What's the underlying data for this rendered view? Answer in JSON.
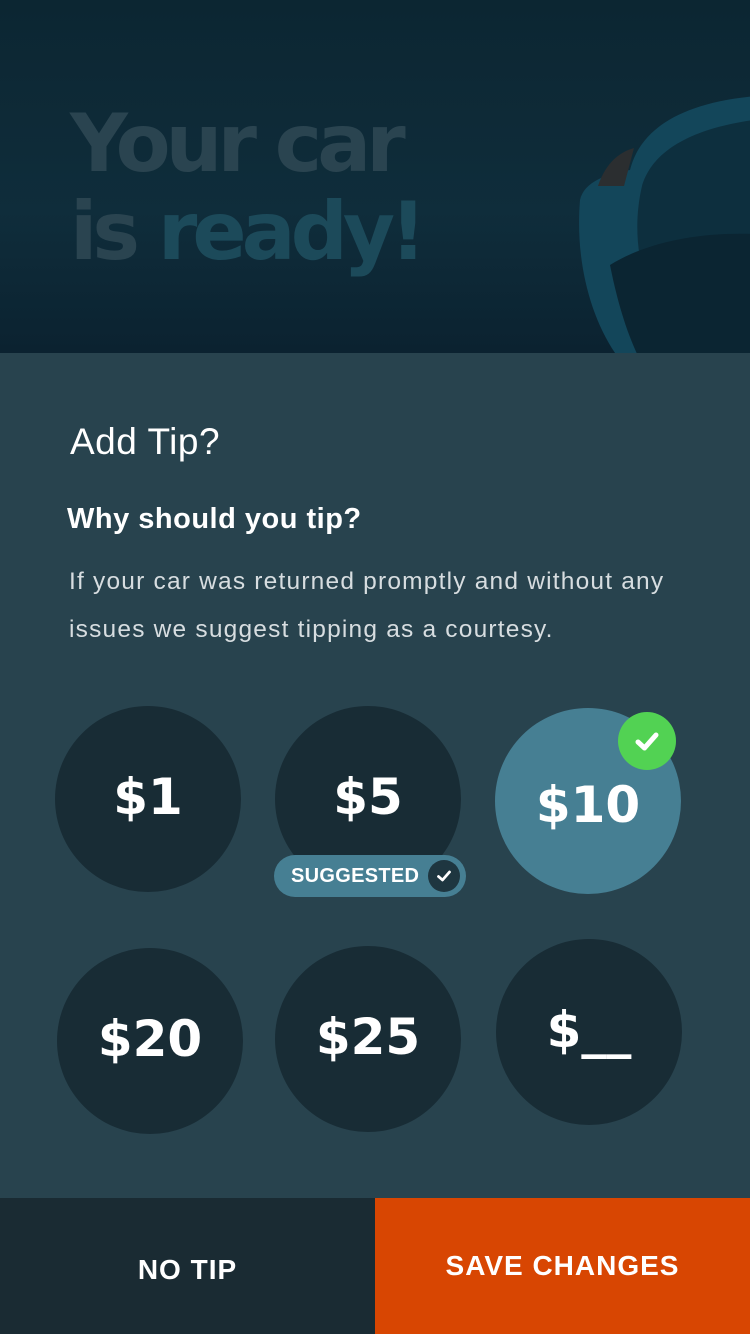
{
  "hero": {
    "title_line1": "Your car",
    "title_line2_a": "is",
    "title_line2_b": "ready!"
  },
  "sheet": {
    "title": "Add Tip?",
    "why_heading": "Why should you tip?",
    "why_body": "If your car was returned promptly and without any issues we suggest tipping as a courtesy."
  },
  "tips": {
    "options": [
      {
        "label": "$1",
        "selected": false
      },
      {
        "label": "$5",
        "selected": false,
        "suggested": true
      },
      {
        "label": "$10",
        "selected": true
      },
      {
        "label": "$20",
        "selected": false
      },
      {
        "label": "$25",
        "selected": false
      },
      {
        "label": "$__",
        "selected": false
      }
    ],
    "suggested_label": "SUGGESTED"
  },
  "actions": {
    "no_tip": "NO TIP",
    "save": "SAVE CHANGES"
  },
  "colors": {
    "sheet_bg": "#28434e",
    "circle_bg": "#182c35",
    "selected_bg": "#467f93",
    "check_green": "#52d253",
    "save_orange": "#d84602"
  }
}
